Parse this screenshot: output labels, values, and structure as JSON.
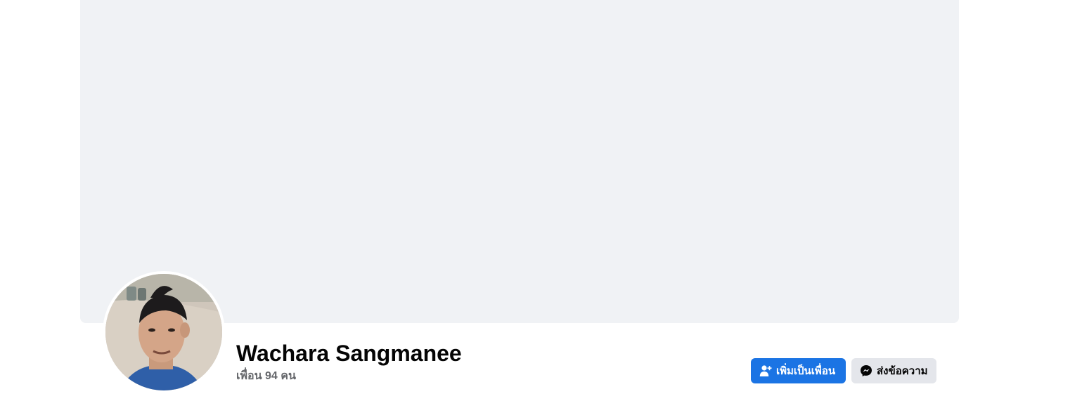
{
  "profile": {
    "name": "Wachara Sangmanee",
    "friend_count_text": "เพื่อน 94 คน"
  },
  "actions": {
    "add_friend_label": "เพิ่มเป็นเพื่อน",
    "message_label": "ส่งข้อความ"
  },
  "icons": {
    "add_friend": "add-friend-icon",
    "messenger": "messenger-icon"
  },
  "colors": {
    "primary_button": "#1b74e4",
    "secondary_button": "#e4e6eb",
    "cover_background": "#f0f2f5",
    "name_text": "#050505",
    "secondary_text": "#65676b"
  }
}
